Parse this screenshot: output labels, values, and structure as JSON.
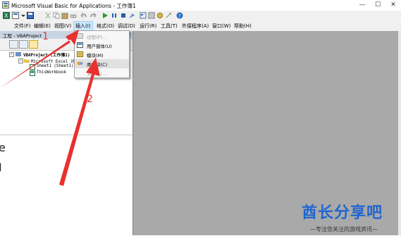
{
  "window": {
    "title": "Microsoft Visual Basic for Applications - 工作簿1",
    "controls": [
      "—",
      "☐",
      "✕"
    ]
  },
  "menubar": {
    "items": [
      {
        "label": "文件(F)"
      },
      {
        "label": "编辑(E)"
      },
      {
        "label": "视图(V)"
      },
      {
        "label": "插入(I)"
      },
      {
        "label": "格式(O)"
      },
      {
        "label": "调试(D)"
      },
      {
        "label": "运行(R)"
      },
      {
        "label": "工具(T)"
      },
      {
        "label": "外接程序(A)"
      },
      {
        "label": "窗口(W)"
      },
      {
        "label": "帮助(H)"
      }
    ]
  },
  "insert_menu": {
    "items": [
      {
        "label": "过程(P)...",
        "enabled": false,
        "icon": "procedure-icon"
      },
      {
        "label": "用户窗体(U)",
        "enabled": true,
        "icon": "userform-icon"
      },
      {
        "label": "模块(M)",
        "enabled": true,
        "icon": "module-icon"
      },
      {
        "label": "类模块(C)",
        "enabled": true,
        "icon": "class-module-icon"
      },
      {
        "label": "文件(L)...",
        "enabled": false,
        "icon": ""
      }
    ]
  },
  "project_panel": {
    "title": "工程 - VBAProject",
    "close": "✕",
    "tree": [
      {
        "label": "VBAProject (工作簿1)",
        "level": 0,
        "bold": true
      },
      {
        "label": "Microsoft Excel 对象",
        "level": 1,
        "bold": false
      },
      {
        "label": "Sheet1 (Sheet1)",
        "level": 2,
        "bold": false
      },
      {
        "label": "ThisWorkbook",
        "level": 2,
        "bold": false
      }
    ]
  },
  "background_doc": {
    "fragments": [
      "e",
      "I"
    ]
  },
  "annotations": {
    "numbers": [
      "1",
      "2"
    ],
    "color": "#e8312f"
  },
  "watermark": {
    "title": "酋长分享吧",
    "subtitle": "—专注您关注的游戏资讯—"
  },
  "colors": {
    "workspace": "#a9a9a9",
    "menu_highlight": "#cce8ff",
    "panel_header": "#c9d4e3"
  }
}
